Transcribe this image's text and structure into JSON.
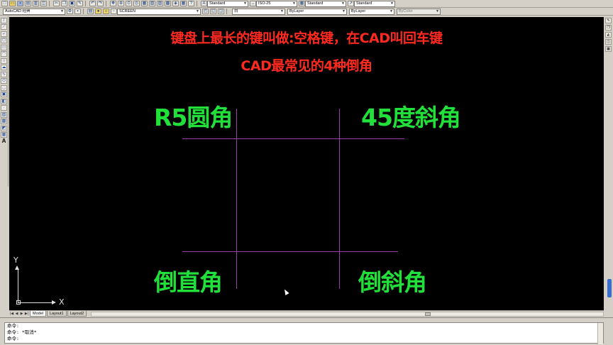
{
  "toolbar": {
    "workspace": "AutoCAD 经典",
    "layer": "SCREEN",
    "text_style": "Standard",
    "dim_style": "ISO-25",
    "table_style": "Standard",
    "multileader_style": "Standard",
    "color": "白",
    "linetype": "ByLayer",
    "lineweight": "ByLayer",
    "plot_style": "ByColor"
  },
  "canvas": {
    "title_line1": "键盘上最长的键叫做:空格键，在CAD叫回车键",
    "title_line2": "CAD最常见的4种倒角",
    "label_top_left": "R5圆角",
    "label_top_right": "45度斜角",
    "label_bottom_left": "倒直角",
    "label_bottom_right": "倒斜角",
    "ucs_y": "Y",
    "ucs_x": "X",
    "colors": {
      "title": "#ff2a1f",
      "labels": "#22e03a",
      "lines": "#9a3da8",
      "background": "#000000"
    }
  },
  "layout_tabs": [
    "Model",
    "Layout1",
    "Layout2"
  ],
  "command": {
    "lines": [
      "命令:",
      "命令: *取消*",
      "命令:"
    ]
  }
}
